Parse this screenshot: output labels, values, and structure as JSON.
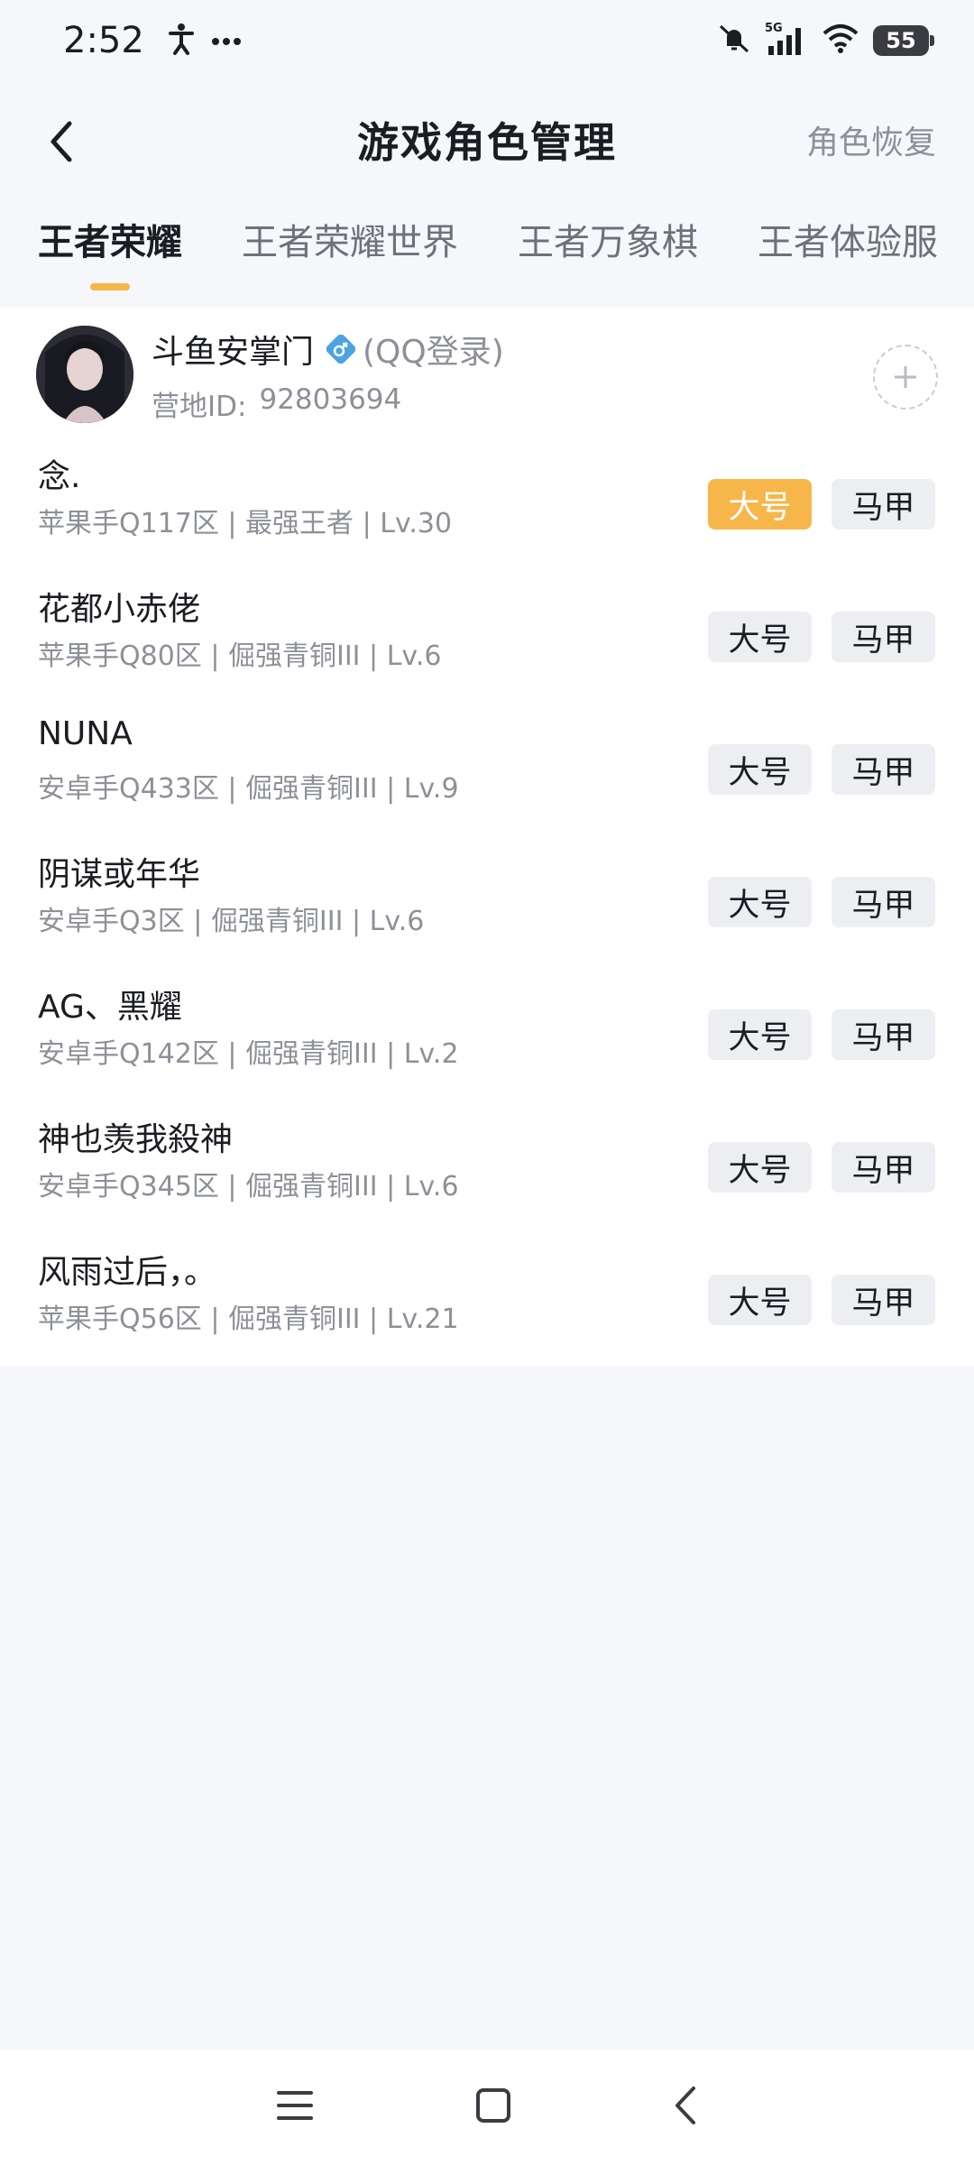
{
  "status": {
    "time": "2:52",
    "network": "5G",
    "battery": "55"
  },
  "header": {
    "title": "游戏角色管理",
    "action": "角色恢复"
  },
  "tabs": [
    "王者荣耀",
    "王者荣耀世界",
    "王者万象棋",
    "王者体验服"
  ],
  "account": {
    "name": "斗鱼安掌门",
    "login_type": "(QQ登录)",
    "id_label": "营地ID:",
    "id_value": "92803694"
  },
  "roles": [
    {
      "name": "念.",
      "meta": "苹果手Q117区 | 最强王者 | Lv.30",
      "main_label": "大号",
      "alt_label": "马甲",
      "selected": true
    },
    {
      "name": "花都小赤佬",
      "meta": "苹果手Q80区 | 倔强青铜III | Lv.6",
      "main_label": "大号",
      "alt_label": "马甲",
      "selected": false
    },
    {
      "name": "NUNA",
      "meta": "安卓手Q433区 | 倔强青铜III | Lv.9",
      "main_label": "大号",
      "alt_label": "马甲",
      "selected": false
    },
    {
      "name": "阴谋或年华",
      "meta": "安卓手Q3区 | 倔强青铜III | Lv.6",
      "main_label": "大号",
      "alt_label": "马甲",
      "selected": false
    },
    {
      "name": "AG、黑耀",
      "meta": "安卓手Q142区 | 倔强青铜III | Lv.2",
      "main_label": "大号",
      "alt_label": "马甲",
      "selected": false
    },
    {
      "name": "神也羡我殺神",
      "meta": "安卓手Q345区 | 倔强青铜III | Lv.6",
      "main_label": "大号",
      "alt_label": "马甲",
      "selected": false
    },
    {
      "name": "风雨过后，。",
      "meta": "苹果手Q56区 | 倔强青铜III | Lv.21",
      "main_label": "大号",
      "alt_label": "马甲",
      "selected": false
    }
  ],
  "colors": {
    "accent": "#f7b64a",
    "page_bg": "#f6f7fb",
    "secondary_text": "#8d9098"
  },
  "icons": {
    "back": "chevron-left-icon",
    "gender": "male-icon",
    "add": "plus-icon",
    "nav_menu": "menu-icon",
    "nav_home": "square-icon",
    "nav_back": "chevron-left-icon"
  }
}
